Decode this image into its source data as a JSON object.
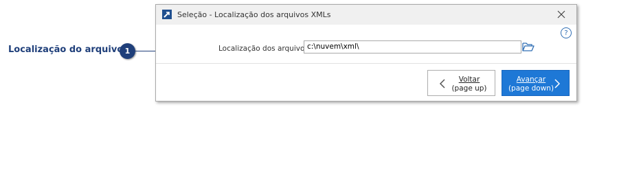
{
  "callout": {
    "label": "Localização do arquivo",
    "badge_number": "1"
  },
  "window": {
    "title": "Seleção - Localização dos arquivos XMLs",
    "icons": {
      "app": "app-icon",
      "close": "close-icon",
      "help": "help-icon",
      "help_glyph": "?",
      "folder": "folder-open-icon"
    }
  },
  "form": {
    "field_label": "Localização dos arquivos",
    "path_value": "c:\\nuvem\\xml\\"
  },
  "buttons": {
    "back_line1": "Voltar",
    "back_line2": "(page up)",
    "next_line1": "Avançar",
    "next_line2": "(page down)"
  },
  "colors": {
    "callout": "#1f3f7a",
    "primary_button": "#1e78d6",
    "titlebar": "#f0f0f0"
  }
}
